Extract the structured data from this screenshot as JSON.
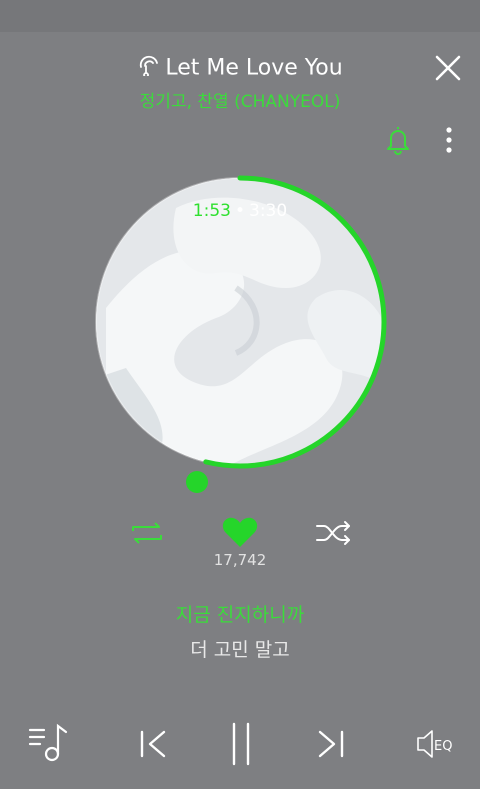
{
  "header": {
    "song_title": "Let Me Love You",
    "artist": "정기고, 찬열 (CHANYEOL)"
  },
  "player": {
    "current_time": "1:53",
    "total_time": "3:30",
    "progress": 0.538,
    "likes": "17,742"
  },
  "lyrics": {
    "current": "지금 진지하니까",
    "next": "더 고민 말고"
  },
  "colors": {
    "accent": "#2fe02f",
    "background": "#7e7f82"
  },
  "icons": [
    "headphone-icon",
    "close-icon",
    "bell-icon",
    "more-icon",
    "repeat-icon",
    "heart-icon",
    "shuffle-icon",
    "playlist-icon",
    "previous-icon",
    "pause-icon",
    "next-icon",
    "equalizer-icon"
  ]
}
